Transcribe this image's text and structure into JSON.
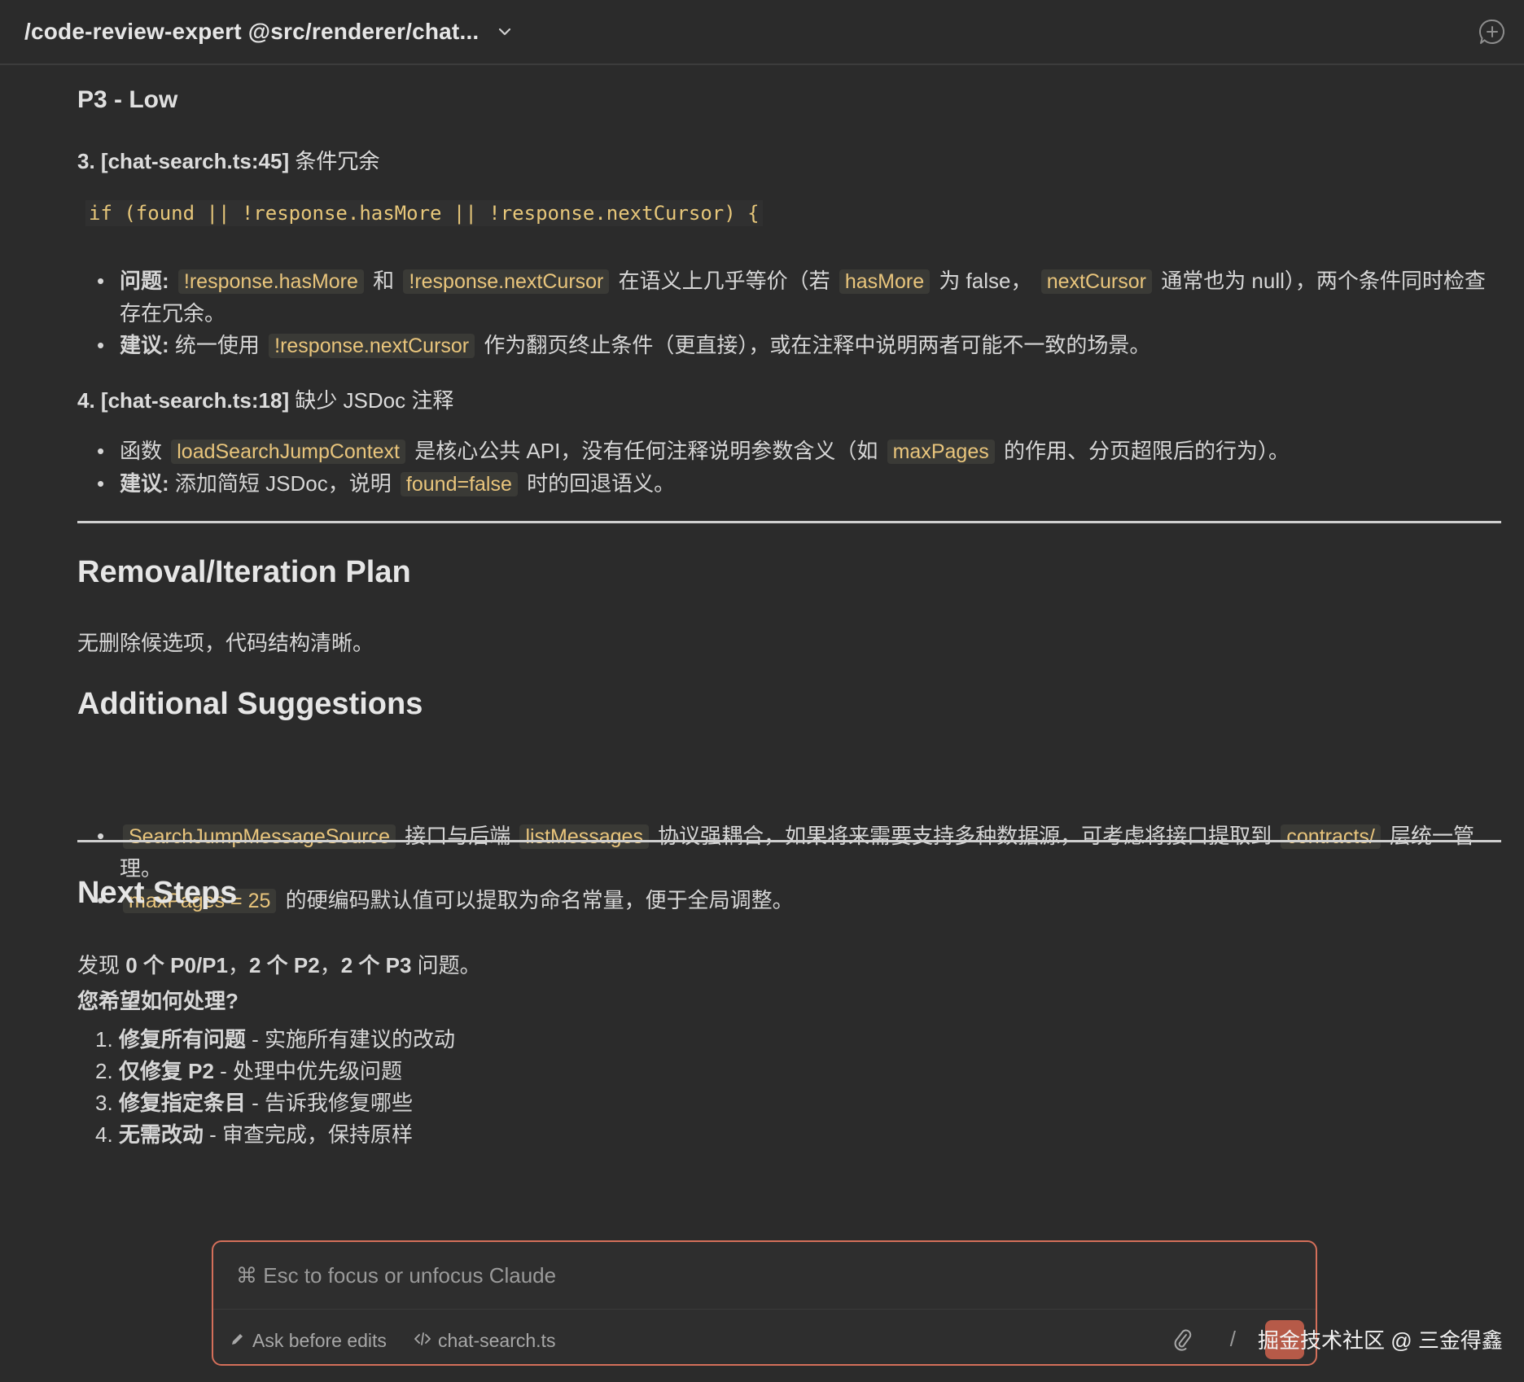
{
  "header": {
    "title": "/code-review-expert @src/renderer/chat..."
  },
  "p3_heading": "P3 - Low",
  "item3": {
    "title_bold": "3. [chat-search.ts:45]",
    "title_text": " 条件冗余",
    "code": "if (found || !response.hasMore || !response.nextCursor) {",
    "bullet1": {
      "label": "问题:",
      "t1": " ",
      "c1": "!response.hasMore",
      "t2": " 和 ",
      "c2": "!response.nextCursor",
      "t3": " 在语义上几乎等价（若 ",
      "c3": "hasMore",
      "t4": " 为 false， ",
      "c4": "nextCursor",
      "t5": " 通常也为 null），两个条件同时检查存在冗余。"
    },
    "bullet2": {
      "label": "建议:",
      "t1": " 统一使用 ",
      "c1": "!response.nextCursor",
      "t2": " 作为翻页终止条件（更直接），或在注释中说明两者可能不一致的场景。"
    }
  },
  "item4": {
    "title_bold": "4. [chat-search.ts:18]",
    "title_text": " 缺少 JSDoc 注释",
    "bullet1": {
      "t1": "函数 ",
      "c1": "loadSearchJumpContext",
      "t2": " 是核心公共 API，没有任何注释说明参数含义（如 ",
      "c2": "maxPages",
      "t3": " 的作用、分页超限后的行为）。"
    },
    "bullet2": {
      "label": "建议:",
      "t1": " 添加简短 JSDoc，说明 ",
      "c1": "found=false",
      "t2": " 时的回退语义。"
    }
  },
  "removal": {
    "heading": "Removal/Iteration Plan",
    "text": "无删除候选项，代码结构清晰。"
  },
  "additional": {
    "heading": "Additional Suggestions",
    "bullet1": {
      "c1": "SearchJumpMessageSource",
      "t1": " 接口与后端 ",
      "c2": "listMessages",
      "t2": " 协议强耦合，如果将来需要支持多种数据源，可考虑将接口提取到 ",
      "c3": "contracts/",
      "t3": " 层统一管理。"
    },
    "bullet2": {
      "c1": "maxPages = 25",
      "t1": " 的硬编码默认值可以提取为命名常量，便于全局调整。"
    }
  },
  "next": {
    "heading": "Next Steps",
    "summary": {
      "t1": "发现 ",
      "b1": "0 个 P0/P1",
      "t2": "，",
      "b2": "2 个 P2",
      "t3": "，",
      "b3": "2 个 P3",
      "t4": " 问题。"
    },
    "question": "您希望如何处理?",
    "options": [
      {
        "num": "1. ",
        "bold": "修复所有问题",
        "text": " - 实施所有建议的改动"
      },
      {
        "num": "2. ",
        "bold": "仅修复 P2",
        "text": " - 处理中优先级问题"
      },
      {
        "num": "3. ",
        "bold": "修复指定条目",
        "text": " - 告诉我修复哪些"
      },
      {
        "num": "4. ",
        "bold": "无需改动",
        "text": " - 审查完成，保持原样"
      }
    ]
  },
  "input": {
    "placeholder": "⌘ Esc to focus or unfocus Claude",
    "mode_label": "Ask before edits",
    "file_label": "chat-search.ts",
    "slash": "/"
  },
  "watermark": "掘金技术社区 @ 三金得鑫",
  "colors": {
    "background": "#2b2b2b",
    "code": "#e9c57c",
    "accent_border": "#d46f5a"
  }
}
